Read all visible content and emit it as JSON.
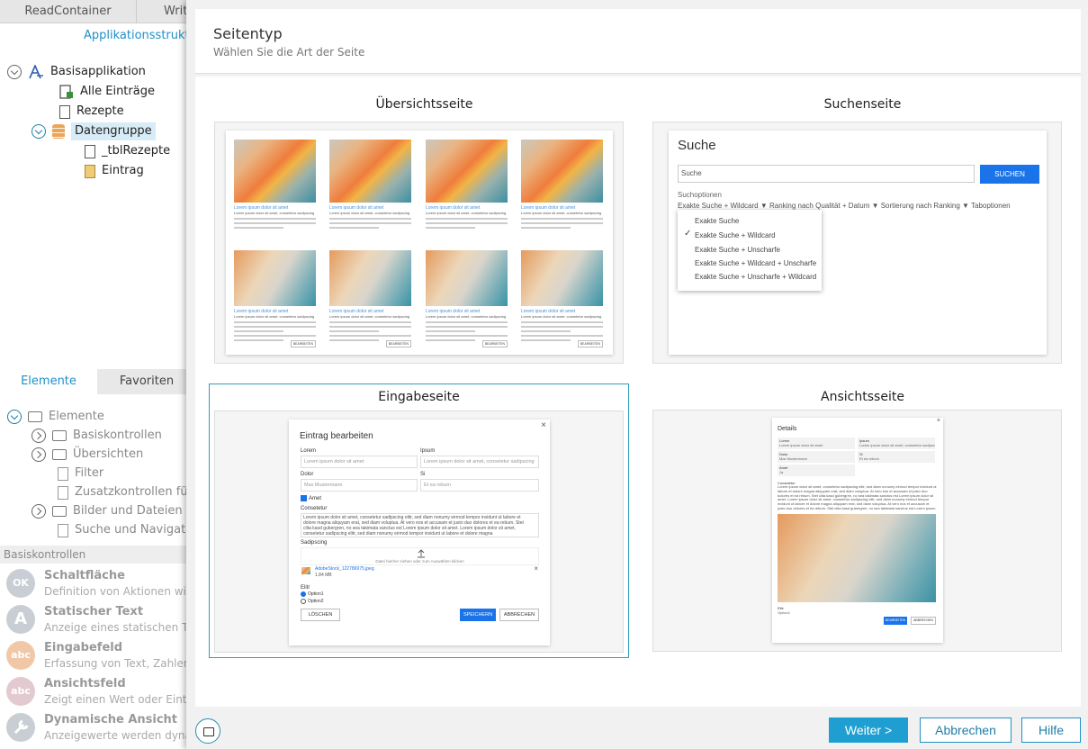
{
  "background_app": {
    "top_tabs": [
      "ReadContainer",
      "Writ"
    ],
    "structure_heading": "Applikationsstruktu",
    "tree": [
      {
        "label": "Basisapplikation"
      },
      {
        "label": "Alle Einträge"
      },
      {
        "label": "Rezepte"
      },
      {
        "label": "Datengruppe"
      },
      {
        "label": "_tblRezepte"
      },
      {
        "label": "Eintrag"
      }
    ],
    "panel_tabs": [
      "Elemente",
      "Favoriten"
    ],
    "elements": [
      "Elemente",
      "Basiskontrollen",
      "Übersichten",
      "Filter",
      "Zusatzkontrollen fü",
      "Bilder und Dateien",
      "Suche und Navigatio"
    ],
    "section_heading": "Basiskontrollen",
    "controls": [
      {
        "icon_text": "OK",
        "title": "Schaltfläche",
        "desc": "Definition von Aktionen wi"
      },
      {
        "icon_text": "A",
        "title": "Statischer Text",
        "desc": "Anzeige eines statischen Te"
      },
      {
        "icon_text": "abc",
        "title": "Eingabefeld",
        "desc": "Erfassung von Text, Zahlen"
      },
      {
        "icon_text": "abc",
        "title": "Ansichtsfeld",
        "desc": "Zeigt einen Wert oder Eintr"
      },
      {
        "icon_text": "",
        "title": "Dynamische Ansicht",
        "desc": "Anzeigewerte werden dyna"
      }
    ]
  },
  "dialog": {
    "title": "Seitentyp",
    "subtitle": "Wählen Sie die Art der Seite",
    "options": [
      {
        "label": "Übersichtsseite"
      },
      {
        "label": "Suchenseite"
      },
      {
        "label": "Eingabeseite"
      },
      {
        "label": "Ansichtsseite"
      }
    ],
    "buttons": {
      "next": "Weiter >",
      "cancel": "Abbrechen",
      "help": "Hilfe"
    }
  },
  "preview_search": {
    "title": "Suche",
    "input_placeholder": "Suche",
    "button": "SUCHEN",
    "options_label": "Suchoptionen",
    "options_row": "Exakte Suche + Wildcard ▼   Ranking nach Qualität + Datum ▼   Sortierung nach Ranking ▼   Taboptionen",
    "menu_items": [
      "Exakte Suche",
      "Exakte Suche + Wildcard",
      "Exakte Suche + Unscharfe",
      "Exakte Suche + Wildcard + Unscharfe",
      "Exakte Suche + Unscharfe + Wildcard"
    ],
    "checked_mark": "✓"
  },
  "preview_form": {
    "title": "Eintrag bearbeiten",
    "close": "×",
    "fields": [
      {
        "label": "Lorem",
        "value": "Lorem ipsum dolor sit amet"
      },
      {
        "label": "Ipsum",
        "value": "Lorem ipsum dolor sit amet, consetetur sadipscing"
      },
      {
        "label": "Dolor",
        "value": "Max Mustermann"
      },
      {
        "label": "Si",
        "value": "Et ea rebum"
      }
    ],
    "checkbox_label": "Amet",
    "textarea_label": "Consetetur",
    "textarea_text": "Lorem ipsum dolor sit amet, consetetur sadipscing elitr, sed diam nonumy eirmod tempor invidunt ut labore et dolore magna aliquyam erat, sed diam voluptua. At vero eos et accusam et justo duo dolores et ea rebum. Stet clita kasd gubergren, no sea takimata sanctus est Lorem ipsum dolor sit amet. Lorem ipsum dolor sit amet, consetetur sadipscing elitr, sed diam nonumy eirmod tempor invidunt ut labore et dolore magna",
    "upload_label": "Sadipscing",
    "upload_hint": "Datei hierher ziehen oder zum Auswählen klicken",
    "file_name": "AdobeStock_122786975.jpeg",
    "file_size": "1.84 MB",
    "radio_label": "Elitr",
    "radios": [
      "Option1",
      "Option2"
    ],
    "btn_delete": "LÖSCHEN",
    "btn_save": "SPEICHERN",
    "btn_cancel": "ABBRECHEN"
  },
  "preview_view": {
    "title": "Details",
    "close": "×",
    "fields": [
      {
        "label": "Lorem",
        "value": "Lorem ipsum dolor sit amet"
      },
      {
        "label": "Ipsum",
        "value": "Lorem ipsum dolor sit amet, consetetur sadipscing"
      },
      {
        "label": "Dolor",
        "value": "Max Mustermann"
      },
      {
        "label": "Si",
        "value": "Et ea rebum"
      },
      {
        "label": "Amet",
        "value": "Ja"
      }
    ],
    "text_label": "Consetetur",
    "text_body": "Lorem ipsum dolor sit amet, consetetur sadipscing elitr, sed diam nonumy eirmod tempor invidunt ut labore et dolore magna aliquyam erat, sed diam voluptua. At vero eos et accusam et justo duo dolores et ea rebum. Stet clita kasd gubergren, no sea takimata sanctus est Lorem ipsum dolor sit amet. Lorem ipsum dolor sit amet, consetetur sadipscing elitr, sed diam nonumy eirmod tempor invidunt ut labore et dolore magna aliquyam erat, sed diam voluptua. At vero eos et accusam et justo duo dolores et ea rebum. Stet clita kasd gubergren, no sea takimata sanctus est Lorem ipsum dolor sit amet.",
    "elitr_label": "Elitr",
    "elitr_value": "Option1",
    "btn_edit": "BEARBEITEN",
    "btn_close": "ABBRECHEN"
  },
  "preview_overview": {
    "card_title": "Lorem ipsum dolor sit amet",
    "card_sub": "Lorem ipsum dolor sit amet, consetetur sadipscing",
    "card_btn": "BEARBEITEN"
  }
}
